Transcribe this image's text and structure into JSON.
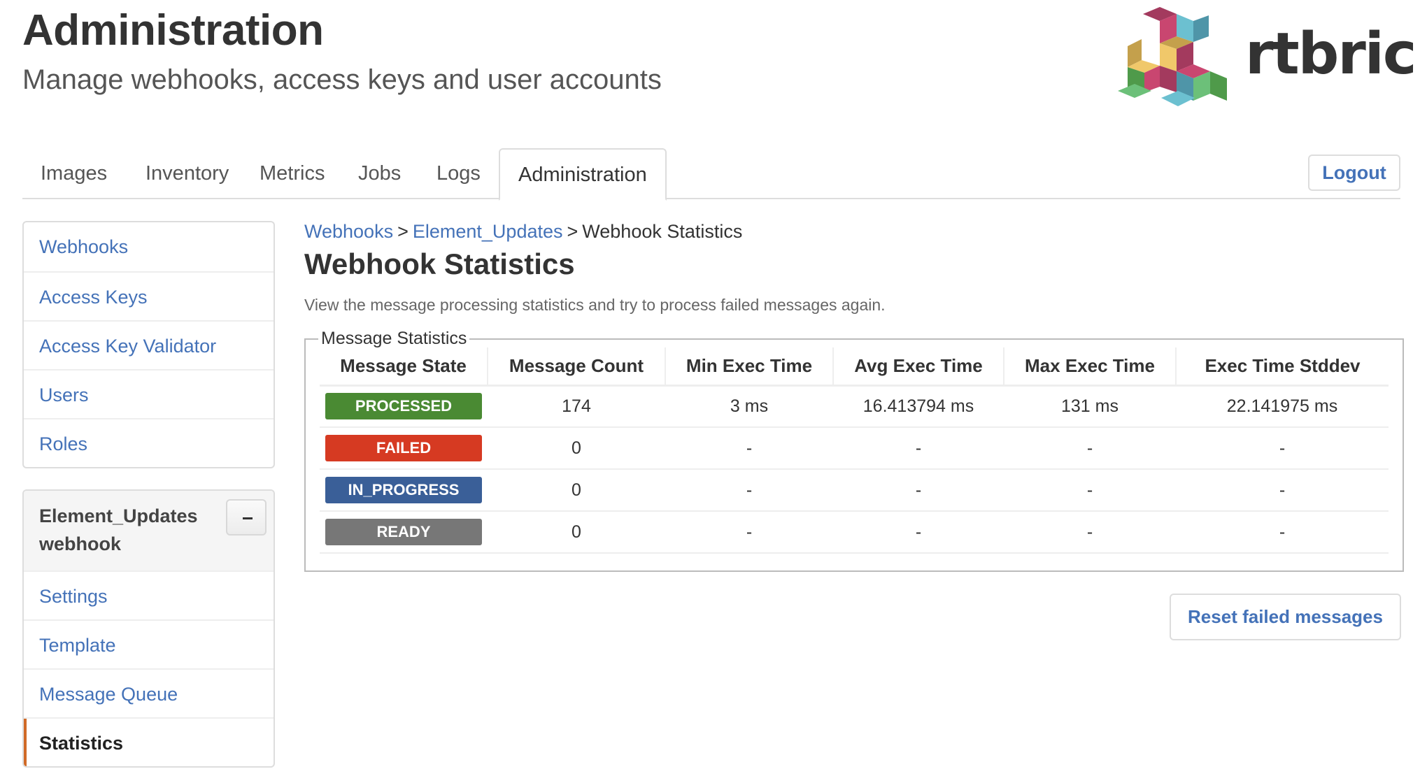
{
  "header": {
    "title": "Administration",
    "subtitle": "Manage webhooks, access keys and user accounts",
    "logo_text": "rtbrick"
  },
  "tabs": [
    {
      "label": "Images",
      "active": false
    },
    {
      "label": "Inventory",
      "active": false
    },
    {
      "label": "Metrics",
      "active": false
    },
    {
      "label": "Jobs",
      "active": false
    },
    {
      "label": "Logs",
      "active": false
    },
    {
      "label": "Administration",
      "active": true
    }
  ],
  "logout_label": "Logout",
  "sidebar": {
    "main_items": [
      {
        "label": "Webhooks"
      },
      {
        "label": "Access Keys"
      },
      {
        "label": "Access Key Validator"
      },
      {
        "label": "Users"
      },
      {
        "label": "Roles"
      }
    ],
    "webhook_panel": {
      "title": "Element_Updates webhook",
      "collapse_icon": "minus-icon",
      "items": [
        {
          "label": "Settings",
          "active": false
        },
        {
          "label": "Template",
          "active": false
        },
        {
          "label": "Message Queue",
          "active": false
        },
        {
          "label": "Statistics",
          "active": true
        }
      ]
    }
  },
  "breadcrumb": {
    "items": [
      "Webhooks",
      "Element_Updates"
    ],
    "separator": ">",
    "current": "Webhook Statistics"
  },
  "main": {
    "title": "Webhook Statistics",
    "description": "View the message processing statistics and try to process failed messages again.",
    "fieldset_legend": "Message Statistics",
    "table": {
      "columns": [
        "Message State",
        "Message Count",
        "Min Exec Time",
        "Avg Exec Time",
        "Max Exec Time",
        "Exec Time Stddev"
      ],
      "rows": [
        {
          "state": "PROCESSED",
          "color": "#4a8a33",
          "count": "174",
          "min": "3 ms",
          "avg": "16.413794 ms",
          "max": "131 ms",
          "stddev": "22.141975 ms"
        },
        {
          "state": "FAILED",
          "color": "#d63a22",
          "count": "0",
          "min": "-",
          "avg": "-",
          "max": "-",
          "stddev": "-"
        },
        {
          "state": "IN_PROGRESS",
          "color": "#3a5f98",
          "count": "0",
          "min": "-",
          "avg": "-",
          "max": "-",
          "stddev": "-"
        },
        {
          "state": "READY",
          "color": "#777777",
          "count": "0",
          "min": "-",
          "avg": "-",
          "max": "-",
          "stddev": "-"
        }
      ]
    },
    "reset_button_label": "Reset failed messages"
  },
  "colors": {
    "link": "#4472b8",
    "active_indicator": "#d06a27"
  }
}
